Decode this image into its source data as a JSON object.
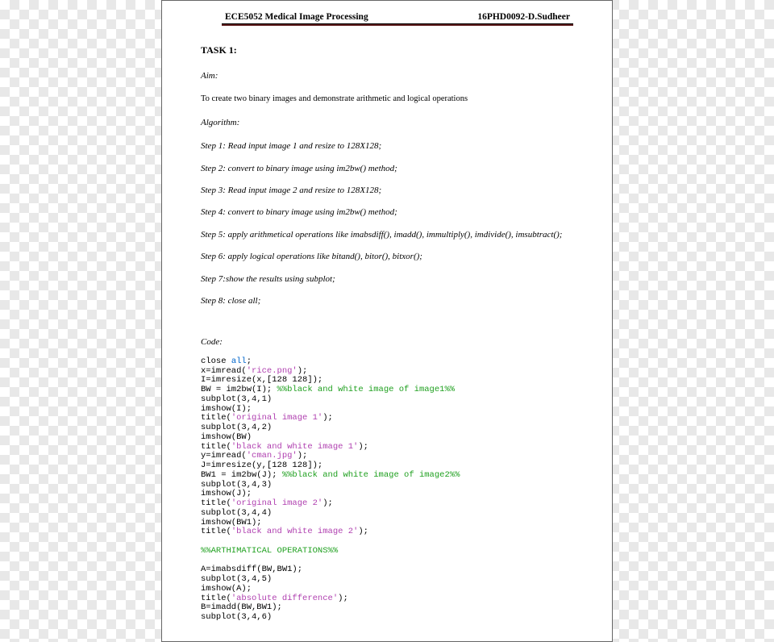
{
  "header": {
    "left": "ECE5052 Medical Image Processing",
    "right": "16PHD0092-D.Sudheer"
  },
  "task": {
    "title": "TASK 1:",
    "aim_label": "Aim:",
    "aim_text": "To create two binary images and demonstrate arithmetic and logical operations",
    "algorithm_label": "Algorithm:",
    "steps": [
      "Step 1: Read input image 1 and resize to 128X128;",
      "Step 2: convert to binary image using im2bw() method;",
      "Step 3: Read input image 2 and resize to 128X128;",
      "Step 4: convert to binary image using im2bw() method;",
      "Step 5: apply arithmetical operations like imabsdiff(), imadd(), immultiply(), imdivide(), imsubtract();",
      "Step 6: apply logical operations like bitand(), bitor(), bitxor();",
      "Step 7:show the results using subplot;",
      "Step 8:  close all;"
    ],
    "code_label": "Code:"
  },
  "code": {
    "l01a": "close ",
    "l01b": "all",
    "l01c": ";",
    "l02a": "x=imread(",
    "l02b": "'rice.png'",
    "l02c": ");",
    "l03": "I=imresize(x,[128 128]);",
    "l04a": "BW = im2bw(I); ",
    "l04b": "%%black and white image of image1%%",
    "l05": "subplot(3,4,1)",
    "l06": "imshow(I);",
    "l07a": "title(",
    "l07b": "'original image 1'",
    "l07c": ");",
    "l08": "subplot(3,4,2)",
    "l09": "imshow(BW)",
    "l10a": "title(",
    "l10b": "'black and white image 1'",
    "l10c": ");",
    "l11a": "y=imread(",
    "l11b": "'cman.jpg'",
    "l11c": ");",
    "l12": "J=imresize(y,[128 128]);",
    "l13a": "BW1 = im2bw(J); ",
    "l13b": "%%black and white image of image2%%",
    "l14": "subplot(3,4,3)",
    "l15": "imshow(J);",
    "l16a": "title(",
    "l16b": "'original image 2'",
    "l16c": ");",
    "l17": "subplot(3,4,4)",
    "l18": "imshow(BW1);",
    "l19a": "title(",
    "l19b": "'black and white image 2'",
    "l19c": ");",
    "l20": "",
    "l21": "%%ARTHIMATICAL OPERATIONS%%",
    "l22": "",
    "l23": "A=imabsdiff(BW,BW1);",
    "l24": "subplot(3,4,5)",
    "l25": "imshow(A);",
    "l26a": "title(",
    "l26b": "'absolute difference'",
    "l26c": ");",
    "l27": "B=imadd(BW,BW1);",
    "l28": "subplot(3,4,6)"
  }
}
